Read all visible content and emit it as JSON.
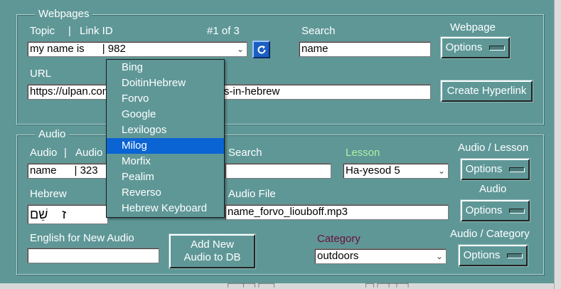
{
  "webpages": {
    "legend": "Webpages",
    "topic_label": "Topic",
    "divider": "|",
    "link_id_label": "Link ID",
    "counter": "#1 of  3",
    "search_label": "Search",
    "webpage_label": "Webpage",
    "topic_value": "my name is      | 982",
    "search_value": "name",
    "options_label": "Options",
    "url_label": "URL",
    "url_value_left": "https://ulpan.com",
    "url_value_right": "s-in-hebrew",
    "create_hyperlink_label": "Create Hyperlink"
  },
  "dropdown": {
    "items": [
      "Bing",
      "DoitinHebrew",
      "Forvo",
      "Google",
      "Lexilogos",
      "Milog",
      "Morfix",
      "Pealim",
      "Reverso",
      "Hebrew Keyboard"
    ],
    "selected": "Milog"
  },
  "audio": {
    "legend": "Audio",
    "audio_label": "Audio",
    "divider": "|",
    "audio_id_label_partial": "Audio",
    "search_label": "Search",
    "lesson_label": "Lesson",
    "audio_lesson_label": "Audio / Lesson",
    "audio_value": "name      | 323",
    "search_value": "",
    "lesson_value": "Ha-yesod 5",
    "options_label": "Options",
    "hebrew_label": "Hebrew",
    "hebrew_value": "ז    שֵׁם",
    "audio_file_label": "Audio File",
    "audio_file_value": "name_forvo_liouboff.mp3",
    "audio_btn_label": "Audio",
    "english_label": "English for New Audio",
    "english_value": "",
    "add_audio_label": "Add New Audio to DB",
    "category_label": "Category",
    "category_value": "outdoors",
    "audio_category_label": "Audio / Category"
  },
  "colors": {
    "background": "#5f9797",
    "lesson_label": "#aef0a0",
    "category_label": "#6a1038",
    "selected_item": "#0a64d4"
  },
  "icons": {
    "refresh": "refresh-icon",
    "combo_arrow": "chevron-down-icon"
  }
}
